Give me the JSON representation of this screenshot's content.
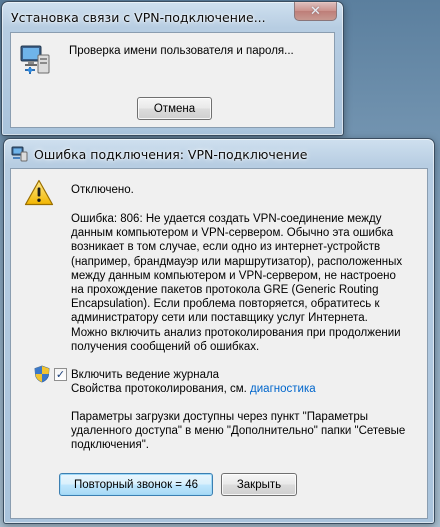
{
  "connecting_dialog": {
    "title": "Установка связи с VPN-подключение...",
    "close_glyph": "✕",
    "status_text": "Проверка имени пользователя и пароля...",
    "cancel_label": "Отмена"
  },
  "error_dialog": {
    "title": "Ошибка подключения: VPN-подключение",
    "close_glyph": "✕",
    "status": "Отключено.",
    "error_lines": [
      "Ошибка: 806: Не удается создать VPN-соединение между",
      "данным компьютером и VPN-сервером. Обычно эта ошибка",
      "возникает в том случае, если одно из интернет-устройств",
      "(например, брандмауэр или маршрутизатор), расположенных",
      "между данным компьютером и VPN-сервером, не настроено",
      "на прохождение пакетов протокола GRE (Generic Routing",
      "Encapsulation).  Если проблема повторяется, обратитесь к",
      "администратору сети или поставщику услуг Интернета."
    ],
    "logging_hint_lines": [
      "Можно включить анализ протоколирования при продолжении",
      "получения сообщений об ошибках."
    ],
    "enable_logging_label": "Включить ведение журнала",
    "enable_logging_checked": true,
    "logging_props_prefix": "Свойства протоколирования, см.",
    "diagnostics_link": "диагностика",
    "boot_params_lines": [
      "Параметры загрузки доступны через пункт \"Параметры",
      "удаленного доступа\" в меню \"Дополнительно\" папки \"Сетевые",
      "подключения\"."
    ],
    "redial_label": "Повторный звонок = 46",
    "close_label": "Закрыть"
  },
  "icons": {
    "network_computer": "network-computer-icon",
    "warning": "warning-icon",
    "shield": "uac-shield-icon",
    "checkmark": "✓"
  },
  "colors": {
    "link": "#0066cc",
    "default_button_border": "#3c7fb1",
    "close_button": "#c4462a"
  }
}
